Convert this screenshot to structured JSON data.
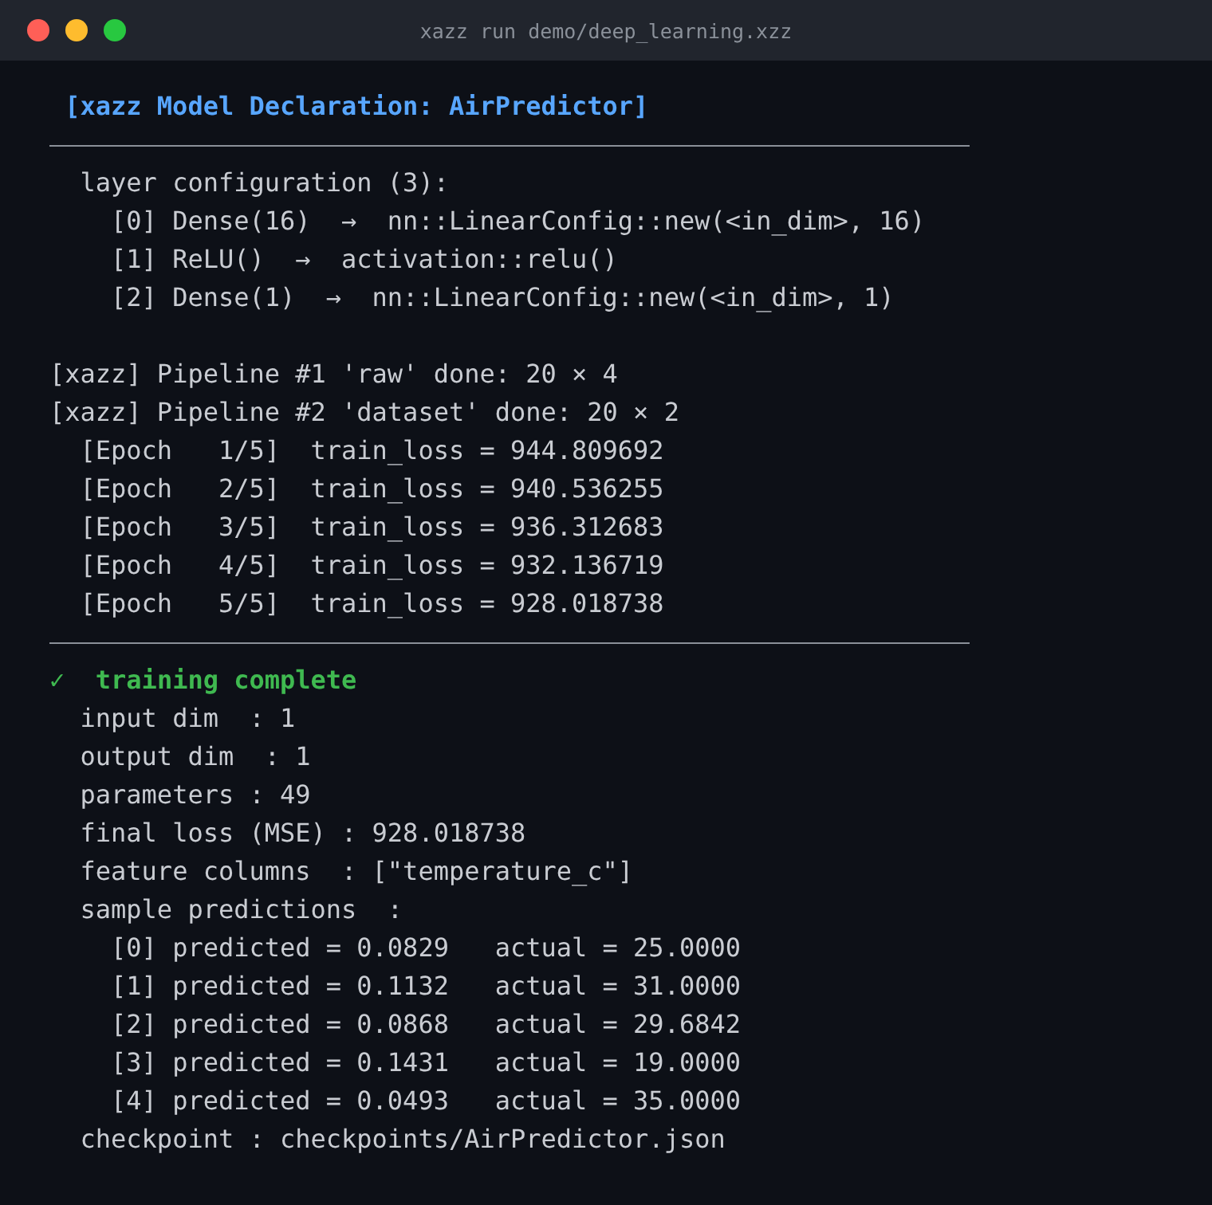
{
  "window": {
    "title": "xazz run demo/deep_learning.xzz"
  },
  "lines": [
    {
      "kind": "heading",
      "text": "[xazz Model Declaration: AirPredictor]"
    },
    {
      "kind": "rule"
    },
    {
      "kind": "detail",
      "text": "layer configuration (3):"
    },
    {
      "kind": "subdetail",
      "text": "[0] Dense(16)  →  nn::LinearConfig::new(<in_dim>, 16)"
    },
    {
      "kind": "subdetail",
      "text": "[1] ReLU()  →  activation::relu()"
    },
    {
      "kind": "subdetail",
      "text": "[2] Dense(1)  →  nn::LinearConfig::new(<in_dim>, 1)"
    },
    {
      "kind": "blank"
    },
    {
      "kind": "plain",
      "text": "[xazz] Pipeline #1 'raw' done: 20 × 4"
    },
    {
      "kind": "plain",
      "text": "[xazz] Pipeline #2 'dataset' done: 20 × 2"
    },
    {
      "kind": "detail",
      "text": "[Epoch   1/5]  train_loss = 944.809692"
    },
    {
      "kind": "detail",
      "text": "[Epoch   2/5]  train_loss = 940.536255"
    },
    {
      "kind": "detail",
      "text": "[Epoch   3/5]  train_loss = 936.312683"
    },
    {
      "kind": "detail",
      "text": "[Epoch   4/5]  train_loss = 932.136719"
    },
    {
      "kind": "detail",
      "text": "[Epoch   5/5]  train_loss = 928.018738"
    },
    {
      "kind": "rule"
    },
    {
      "kind": "success",
      "mark": "✓",
      "text": "training complete"
    },
    {
      "kind": "detail",
      "text": "input dim  : 1"
    },
    {
      "kind": "detail",
      "text": "output dim  : 1"
    },
    {
      "kind": "detail",
      "text": "parameters : 49"
    },
    {
      "kind": "detail",
      "text": "final loss (MSE) : 928.018738"
    },
    {
      "kind": "detail",
      "text": "feature columns  : [\"temperature_c\"]"
    },
    {
      "kind": "detail",
      "text": "sample predictions  :"
    },
    {
      "kind": "subdetail",
      "text": "[0] predicted = 0.0829   actual = 25.0000"
    },
    {
      "kind": "subdetail",
      "text": "[1] predicted = 0.1132   actual = 31.0000"
    },
    {
      "kind": "subdetail",
      "text": "[2] predicted = 0.0868   actual = 29.6842"
    },
    {
      "kind": "subdetail",
      "text": "[3] predicted = 0.1431   actual = 19.0000"
    },
    {
      "kind": "subdetail",
      "text": "[4] predicted = 0.0493   actual = 35.0000"
    },
    {
      "kind": "detail",
      "text": "checkpoint : checkpoints/AirPredictor.json"
    }
  ]
}
